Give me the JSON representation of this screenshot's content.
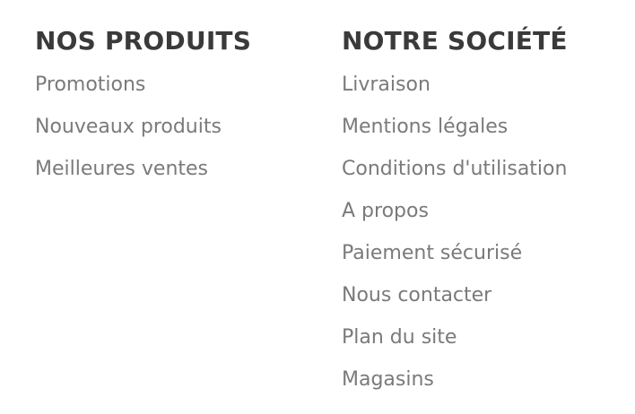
{
  "products": {
    "heading": "NOS PRODUITS",
    "links": [
      "Promotions",
      "Nouveaux produits",
      "Meilleures ventes"
    ]
  },
  "company": {
    "heading": "NOTRE SOCIÉTÉ",
    "links": [
      "Livraison",
      "Mentions légales",
      "Conditions d'utilisation",
      "A propos",
      "Paiement sécurisé",
      "Nous contacter",
      "Plan du site",
      "Magasins"
    ]
  },
  "colors": {
    "heading": "#3a3a3a",
    "link": "#7a7a7a",
    "background": "#ffffff"
  }
}
